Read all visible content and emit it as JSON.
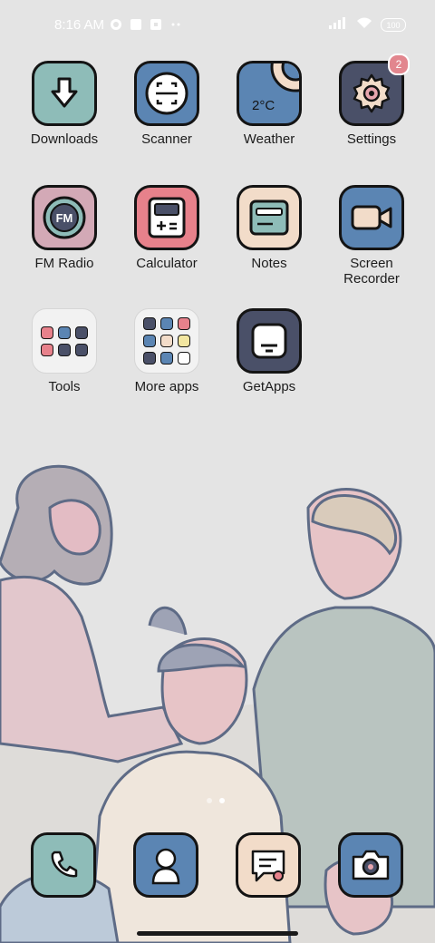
{
  "status_bar": {
    "time": "8:16 AM",
    "battery": "100"
  },
  "apps": [
    {
      "label": "Downloads",
      "icon": "download-icon",
      "color": "#8ebcb8"
    },
    {
      "label": "Scanner",
      "icon": "scanner-icon",
      "color": "#5b85b3"
    },
    {
      "label": "Weather",
      "icon": "weather-icon",
      "color": "#5b85b3",
      "temp": "2°C"
    },
    {
      "label": "Settings",
      "icon": "gear-icon",
      "color": "#4a5068",
      "badge": "2"
    },
    {
      "label": "FM Radio",
      "icon": "radio-icon",
      "color": "#d3a9b6",
      "text": "FM"
    },
    {
      "label": "Calculator",
      "icon": "calculator-icon",
      "color": "#e7818b"
    },
    {
      "label": "Notes",
      "icon": "notes-icon",
      "color": "#f2dcc9"
    },
    {
      "label": "Screen\nRecorder",
      "icon": "video-camera-icon",
      "color": "#5b85b3"
    },
    {
      "label": "Tools",
      "icon": "folder-icon"
    },
    {
      "label": "More apps",
      "icon": "folder-icon"
    },
    {
      "label": "GetApps",
      "icon": "store-icon",
      "color": "#4a5068"
    }
  ],
  "dock": [
    {
      "name": "phone",
      "icon": "phone-icon",
      "color": "#8ebcb8"
    },
    {
      "name": "contacts",
      "icon": "person-icon",
      "color": "#5b85b3"
    },
    {
      "name": "messages",
      "icon": "chat-icon",
      "color": "#f2dcc9"
    },
    {
      "name": "camera",
      "icon": "camera-icon",
      "color": "#5b85b3"
    }
  ],
  "page_indicator": {
    "pages": 2,
    "current": 2
  }
}
